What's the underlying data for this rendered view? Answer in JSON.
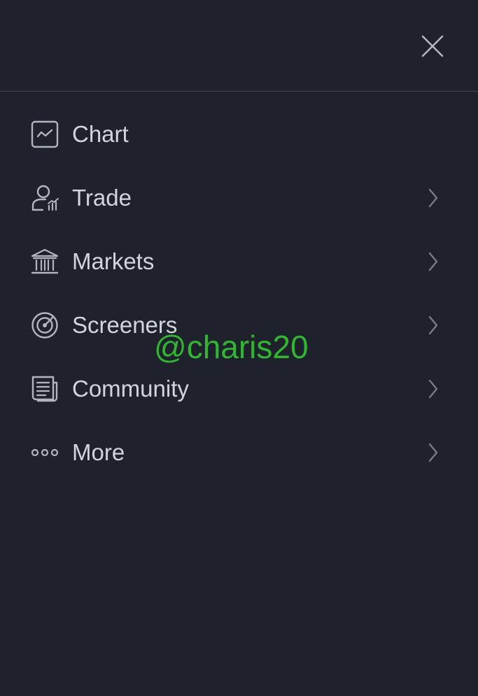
{
  "header": {
    "close_icon": "close-icon"
  },
  "menu": {
    "items": [
      {
        "label": "Chart",
        "icon": "chart-icon",
        "has_submenu": false
      },
      {
        "label": "Trade",
        "icon": "trade-icon",
        "has_submenu": true
      },
      {
        "label": "Markets",
        "icon": "bank-icon",
        "has_submenu": true
      },
      {
        "label": "Screeners",
        "icon": "target-icon",
        "has_submenu": true
      },
      {
        "label": "Community",
        "icon": "newspaper-icon",
        "has_submenu": true
      },
      {
        "label": "More",
        "icon": "more-icon",
        "has_submenu": true
      }
    ]
  },
  "watermark": {
    "text": "@charis20"
  },
  "colors": {
    "background": "#1f222c",
    "text": "#d1d4dc",
    "icon": "#b2b5be",
    "chevron": "#787b86",
    "divider": "#434651",
    "watermark": "#2eb82e"
  }
}
